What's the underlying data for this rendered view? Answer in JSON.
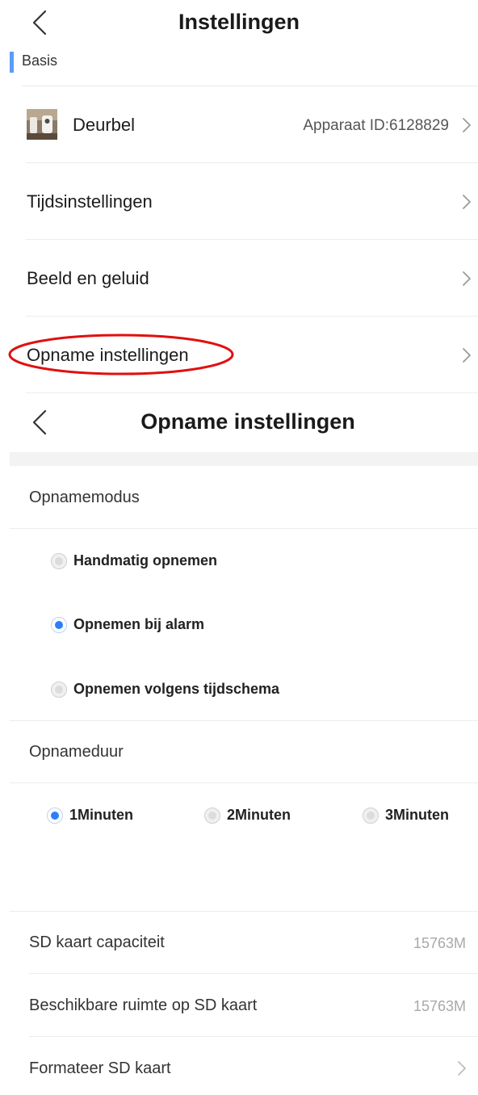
{
  "screen1": {
    "title": "Instellingen",
    "section_label": "Basis",
    "accent_color": "#5b9cf6",
    "device": {
      "name": "Deurbel",
      "id_text": "Apparaat ID:6128829"
    },
    "items": [
      {
        "label": "Tijdsinstellingen"
      },
      {
        "label": "Beeld en geluid"
      },
      {
        "label": "Opname instellingen"
      }
    ],
    "highlight_color": "#e01010"
  },
  "screen2": {
    "title": "Opname instellingen",
    "mode_header": "Opnamemodus",
    "modes": [
      {
        "label": "Handmatig opnemen",
        "selected": false
      },
      {
        "label": "Opnemen bij alarm",
        "selected": true
      },
      {
        "label": "Opnemen volgens tijdschema",
        "selected": false
      }
    ],
    "duration_header": "Opnameduur",
    "durations": [
      {
        "label": "1Minuten",
        "selected": true
      },
      {
        "label": "2Minuten",
        "selected": false
      },
      {
        "label": "3Minuten",
        "selected": false
      }
    ],
    "sd_capacity": {
      "label": "SD kaart capaciteit",
      "value": "15763M"
    },
    "sd_free": {
      "label": "Beschikbare ruimte op SD kaart",
      "value": "15763M"
    },
    "format_sd": {
      "label": "Formateer SD kaart"
    },
    "selected_color": "#2d7ff9"
  }
}
